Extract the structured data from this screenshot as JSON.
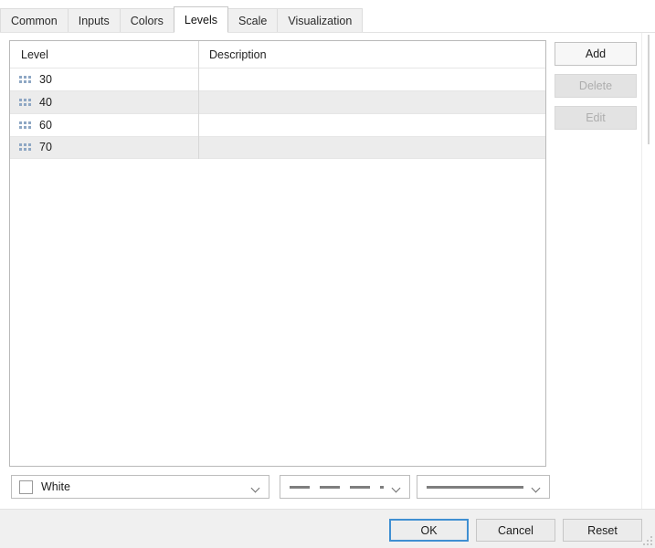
{
  "tabs": [
    {
      "label": "Common",
      "selected": false
    },
    {
      "label": "Inputs",
      "selected": false
    },
    {
      "label": "Colors",
      "selected": false
    },
    {
      "label": "Levels",
      "selected": true
    },
    {
      "label": "Scale",
      "selected": false
    },
    {
      "label": "Visualization",
      "selected": false
    }
  ],
  "table": {
    "columns": [
      {
        "key": "level",
        "label": "Level"
      },
      {
        "key": "description",
        "label": "Description"
      }
    ],
    "rows": [
      {
        "handle_icon": "drag-handle-icon",
        "level": "30",
        "description": ""
      },
      {
        "handle_icon": "drag-handle-icon",
        "level": "40",
        "description": ""
      },
      {
        "handle_icon": "drag-handle-icon",
        "level": "60",
        "description": ""
      },
      {
        "handle_icon": "drag-handle-icon",
        "level": "70",
        "description": ""
      }
    ]
  },
  "side_buttons": [
    {
      "label": "Add",
      "enabled": true
    },
    {
      "label": "Delete",
      "enabled": false
    },
    {
      "label": "Edit",
      "enabled": false
    }
  ],
  "selects": {
    "color": {
      "value": "White",
      "swatch_hex": "#ffffff",
      "caret_icon": "chevron-down-icon"
    },
    "line_style": {
      "value": "dashed",
      "caret_icon": "chevron-down-icon"
    },
    "line_width": {
      "value": "solid",
      "caret_icon": "chevron-down-icon"
    }
  },
  "footer": {
    "ok": "OK",
    "cancel": "Cancel",
    "reset": "Reset",
    "focus_hex": "#3f8fd2",
    "resize_grip_icon": "resize-grip-icon"
  }
}
